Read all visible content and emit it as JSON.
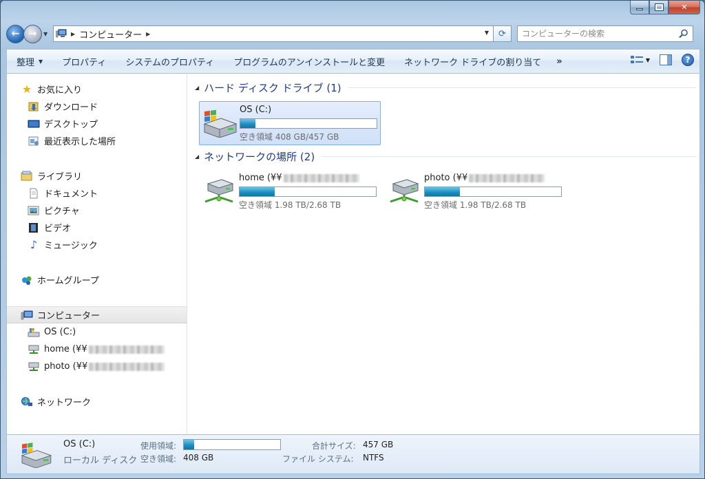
{
  "window": {
    "controls": {
      "minimize": "minimize",
      "maximize": "maximize",
      "close": "close"
    }
  },
  "address": {
    "crumbs": [
      "コンピューター"
    ],
    "search_placeholder": "コンピューターの検索"
  },
  "toolbar": {
    "organize": "整理",
    "properties": "プロパティ",
    "system_properties": "システムのプロパティ",
    "uninstall": "プログラムのアンインストールと変更",
    "map_drive": "ネットワーク ドライブの割り当て",
    "more": "»"
  },
  "sidebar": {
    "favorites": "お気に入り",
    "downloads": "ダウンロード",
    "desktop": "デスクトップ",
    "recent": "最近表示した場所",
    "libraries": "ライブラリ",
    "documents": "ドキュメント",
    "pictures": "ピクチャ",
    "videos": "ビデオ",
    "music": "ミュージック",
    "homegroup": "ホームグループ",
    "computer": "コンピューター",
    "os_drive": "OS (C:)",
    "home_drive": "home (¥¥",
    "photo_drive": "photo (¥¥",
    "network": "ネットワーク"
  },
  "groups": {
    "hdd_title": "ハード ディスク ドライブ (1)",
    "network_title": "ネットワークの場所 (2)"
  },
  "drives": {
    "os": {
      "name": "OS (C:)",
      "free": "空き領域 408 GB/457 GB",
      "used_fraction": 0.11
    },
    "home": {
      "name": "home (¥¥",
      "free": "空き領域 1.98 TB/2.68 TB",
      "used_fraction": 0.26
    },
    "photo": {
      "name": "photo (¥¥",
      "free": "空き領域 1.98 TB/2.68 TB",
      "used_fraction": 0.26
    }
  },
  "details": {
    "name": "OS (C:)",
    "type": "ローカル ディスク",
    "used_label": "使用領域:",
    "free_label": "空き領域:",
    "free_value": "408 GB",
    "total_label": "合計サイズ:",
    "total_value": "457 GB",
    "fs_label": "ファイル システム:",
    "fs_value": "NTFS",
    "used_fraction": 0.11
  }
}
